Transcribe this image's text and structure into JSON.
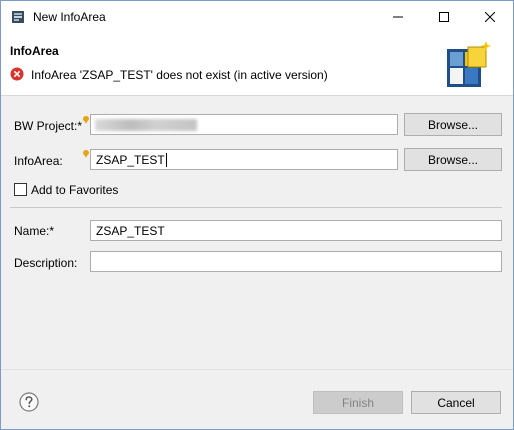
{
  "window": {
    "title": "New InfoArea",
    "app_icon": "eclipse-window-icon",
    "minimize_icon": "minimize-icon",
    "maximize_icon": "maximize-icon",
    "close_icon": "close-icon"
  },
  "banner": {
    "title": "InfoArea",
    "message": "InfoArea 'ZSAP_TEST' does not exist (in active version)",
    "status_icon": "error-icon",
    "graphic_icon": "infoarea-wizard-icon"
  },
  "form": {
    "bw_project_label": "BW Project:*",
    "bw_project_value": "",
    "infoarea_label": "InfoArea:",
    "infoarea_value": "ZSAP_TEST",
    "browse_label": "Browse...",
    "add_to_favorites_label": "Add to Favorites",
    "add_to_favorites_checked": false,
    "name_label": "Name:*",
    "name_value": "ZSAP_TEST",
    "description_label": "Description:",
    "description_value": ""
  },
  "footer": {
    "help_icon": "help-icon",
    "finish_label": "Finish",
    "cancel_label": "Cancel"
  },
  "colors": {
    "error": "#d9342b",
    "required_marker": "#e8a317",
    "disabled_button": "#cccccc",
    "window_border": "#7a9cc6"
  }
}
